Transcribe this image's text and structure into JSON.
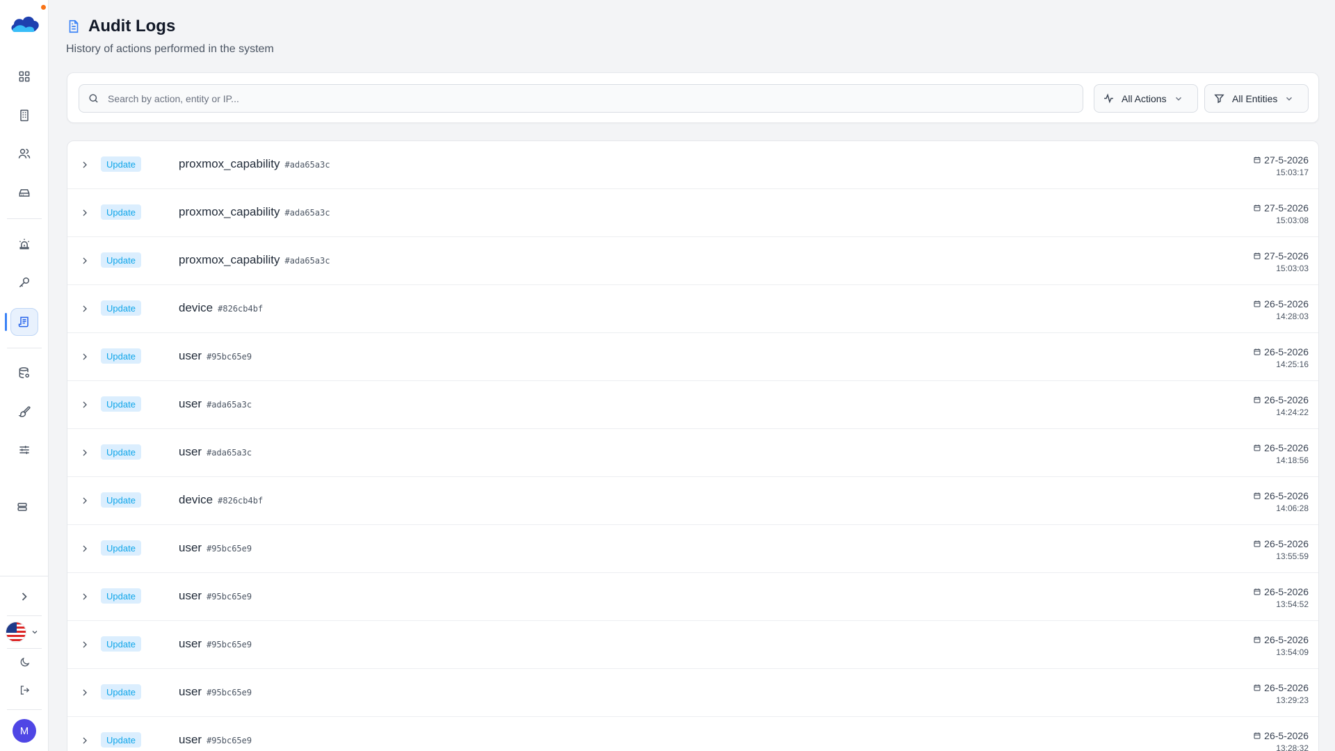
{
  "header": {
    "title": "Audit Logs",
    "subtitle": "History of actions performed in the system"
  },
  "filters": {
    "search_placeholder": "Search by action, entity or IP...",
    "actions_label": "All Actions",
    "entities_label": "All Entities"
  },
  "sidebar": {
    "items": [
      {
        "icon": "dashboard-grid-icon"
      },
      {
        "icon": "building-icon"
      },
      {
        "icon": "users-icon"
      },
      {
        "icon": "hard-drive-icon"
      },
      {
        "icon": "alarm-siren-icon"
      },
      {
        "icon": "key-icon"
      },
      {
        "icon": "audit-log-icon",
        "active": true
      },
      {
        "icon": "database-icon"
      },
      {
        "icon": "paintbrush-icon"
      },
      {
        "icon": "sliders-icon"
      },
      {
        "icon": "server-icon"
      }
    ],
    "avatar_initial": "M",
    "accent": "#3b82f6"
  },
  "logs": [
    {
      "action": "Update",
      "entity": "proxmox_capability",
      "id": "#ada65a3c",
      "date": "27-5-2026",
      "time": "15:03:17"
    },
    {
      "action": "Update",
      "entity": "proxmox_capability",
      "id": "#ada65a3c",
      "date": "27-5-2026",
      "time": "15:03:08"
    },
    {
      "action": "Update",
      "entity": "proxmox_capability",
      "id": "#ada65a3c",
      "date": "27-5-2026",
      "time": "15:03:03"
    },
    {
      "action": "Update",
      "entity": "device",
      "id": "#826cb4bf",
      "date": "26-5-2026",
      "time": "14:28:03"
    },
    {
      "action": "Update",
      "entity": "user",
      "id": "#95bc65e9",
      "date": "26-5-2026",
      "time": "14:25:16"
    },
    {
      "action": "Update",
      "entity": "user",
      "id": "#ada65a3c",
      "date": "26-5-2026",
      "time": "14:24:22"
    },
    {
      "action": "Update",
      "entity": "user",
      "id": "#ada65a3c",
      "date": "26-5-2026",
      "time": "14:18:56"
    },
    {
      "action": "Update",
      "entity": "device",
      "id": "#826cb4bf",
      "date": "26-5-2026",
      "time": "14:06:28"
    },
    {
      "action": "Update",
      "entity": "user",
      "id": "#95bc65e9",
      "date": "26-5-2026",
      "time": "13:55:59"
    },
    {
      "action": "Update",
      "entity": "user",
      "id": "#95bc65e9",
      "date": "26-5-2026",
      "time": "13:54:52"
    },
    {
      "action": "Update",
      "entity": "user",
      "id": "#95bc65e9",
      "date": "26-5-2026",
      "time": "13:54:09"
    },
    {
      "action": "Update",
      "entity": "user",
      "id": "#95bc65e9",
      "date": "26-5-2026",
      "time": "13:29:23"
    },
    {
      "action": "Update",
      "entity": "user",
      "id": "#95bc65e9",
      "date": "26-5-2026",
      "time": "13:28:32"
    }
  ]
}
